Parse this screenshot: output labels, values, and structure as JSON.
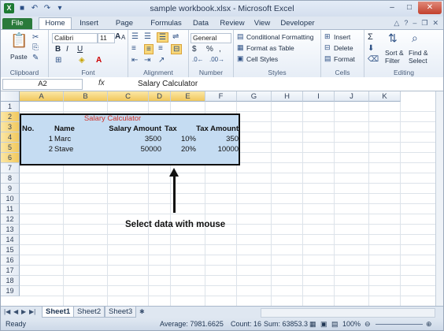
{
  "window": {
    "title": "sample workbook.xlsx - Microsoft Excel"
  },
  "tabs": [
    {
      "label": "File"
    },
    {
      "label": "Home"
    },
    {
      "label": "Insert"
    },
    {
      "label": "Page Layout"
    },
    {
      "label": "Formulas"
    },
    {
      "label": "Data"
    },
    {
      "label": "Review"
    },
    {
      "label": "View"
    },
    {
      "label": "Developer"
    }
  ],
  "ribbon": {
    "clipboard": {
      "label": "Clipboard",
      "paste": "Paste"
    },
    "font": {
      "label": "Font",
      "name": "Calibri",
      "size": "11",
      "bold": "B",
      "italic": "I",
      "underline": "U",
      "grow": "A",
      "shrink": "A"
    },
    "alignment": {
      "label": "Alignment"
    },
    "number": {
      "label": "Number",
      "format": "General",
      "currency": "$",
      "percent": "%",
      "comma": ","
    },
    "styles": {
      "label": "Styles",
      "conditional": "Conditional Formatting",
      "format_table": "Format as Table",
      "cell_styles": "Cell Styles"
    },
    "cells": {
      "label": "Cells",
      "insert": "Insert",
      "delete": "Delete",
      "format": "Format"
    },
    "editing": {
      "label": "Editing",
      "sigma": "Σ",
      "sort": "Sort &",
      "filter": "Filter",
      "find": "Find &",
      "select": "Select"
    }
  },
  "formula_bar": {
    "name_box": "A2",
    "fx": "fx",
    "value": "Salary Calculator"
  },
  "columns": [
    "A",
    "B",
    "C",
    "D",
    "E",
    "F",
    "G",
    "H",
    "I",
    "J",
    "K"
  ],
  "rows": [
    "1",
    "2",
    "3",
    "4",
    "5",
    "6",
    "7",
    "8",
    "9",
    "10",
    "11",
    "12",
    "13",
    "14",
    "15",
    "16",
    "17",
    "18",
    "19"
  ],
  "sheet": {
    "title": "Salary Calculator",
    "headers": [
      "No.",
      "Name",
      "Salary Amount",
      "Tax",
      "Tax Amount"
    ],
    "data": [
      [
        "1",
        "Marc",
        "3500",
        "10%",
        "350"
      ],
      [
        "2",
        "Stave",
        "50000",
        "20%",
        "10000"
      ]
    ]
  },
  "annotation": "Select data with mouse",
  "sheet_tabs": [
    "Sheet1",
    "Sheet2",
    "Sheet3"
  ],
  "status": {
    "mode": "Ready",
    "average": "Average: 7981.6625",
    "count": "Count: 16",
    "sum": "Sum: 63853.3",
    "zoom": "100%"
  }
}
